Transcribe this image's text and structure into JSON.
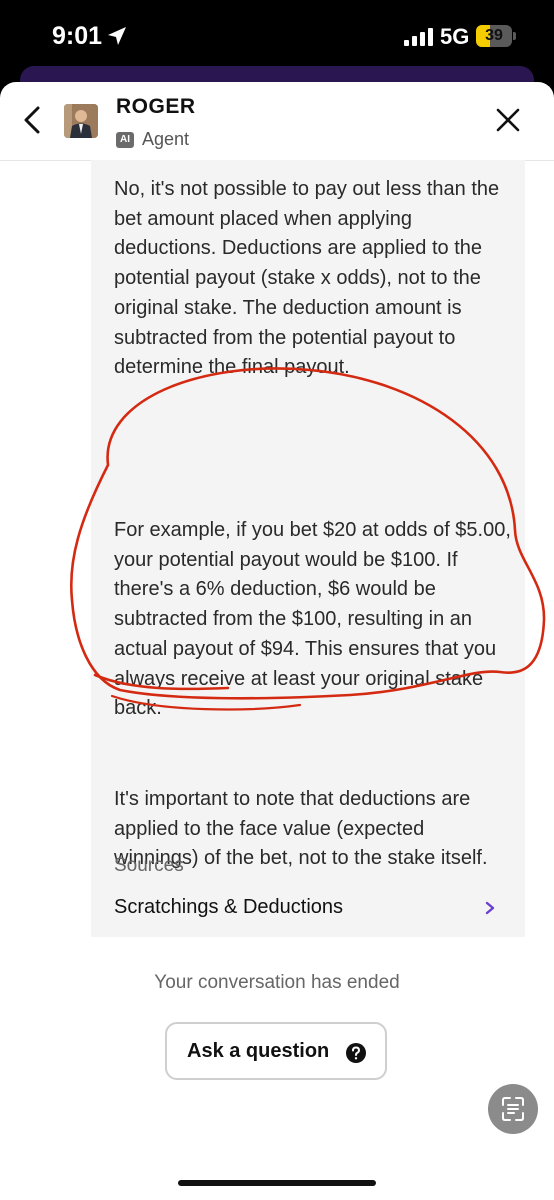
{
  "status_bar": {
    "time": "9:01",
    "network": "5G",
    "battery": "39",
    "battery_level": 0.39,
    "icons": [
      "location-arrow-icon",
      "signal-icon",
      "battery-icon"
    ]
  },
  "header": {
    "agent_name": "ROGER",
    "badge": "AI",
    "role": "Agent",
    "icons": [
      "chevron-left-icon",
      "close-icon"
    ]
  },
  "message": {
    "paragraphs": [
      "No, it's not possible to pay out less than the bet amount placed when applying deductions. Deductions are applied to the potential payout (stake x odds), not to the original stake. The deduction amount is subtracted from the potential payout to determine the final payout.",
      "For example, if you bet $20 at odds of $5.00, your potential payout would be $100. If there's a 6% deduction, $6 would be subtracted from the $100, resulting in an actual payout of $94. This ensures that you always receive at least your original stake back.",
      "It's important to note that deductions are applied to the face value (expected winnings) of the bet, not to the stake itself."
    ],
    "sources_heading": "Sources",
    "source_link": "Scratchings & Deductions"
  },
  "footer": {
    "ended_text": "Your conversation has ended",
    "ask_button": "Ask a question"
  },
  "colors": {
    "accent": "#6a3fd4",
    "annotation": "#d42a12",
    "bubble": "#f4f4f4"
  }
}
